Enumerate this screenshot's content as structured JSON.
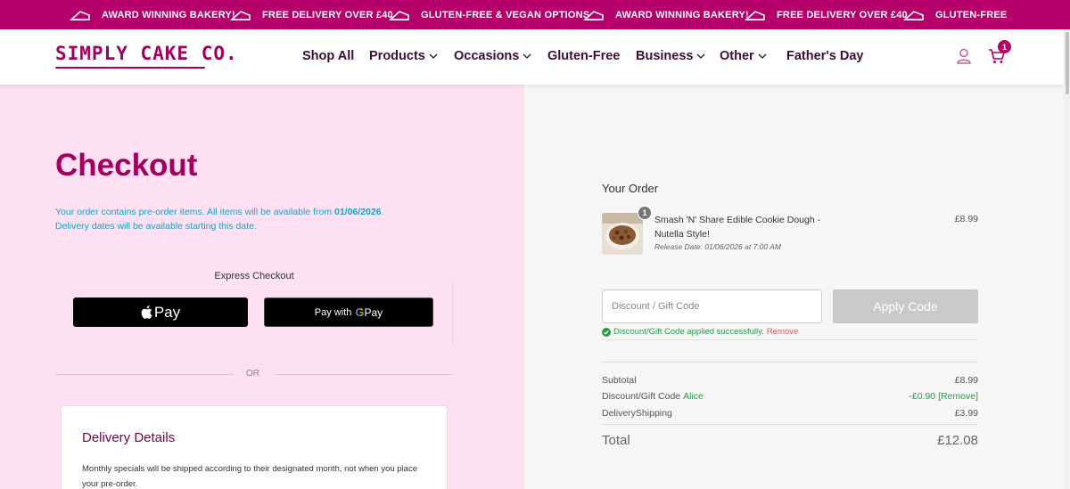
{
  "announcement": {
    "items": [
      "AWARD WINNING BAKERY!",
      "FREE DELIVERY OVER £40",
      "GLUTEN-FREE & VEGAN OPTIONS",
      "AWARD WINNING BAKERY!",
      "FREE DELIVERY OVER £40",
      "GLUTEN-FREE"
    ],
    "icon": "cake-icon"
  },
  "header": {
    "logo": "SIMPLY CAKE CO.",
    "nav": [
      {
        "label": "Shop All",
        "dropdown": false
      },
      {
        "label": "Products",
        "dropdown": true
      },
      {
        "label": "Occasions",
        "dropdown": true
      },
      {
        "label": "Gluten-Free",
        "dropdown": false
      },
      {
        "label": "Business",
        "dropdown": true
      },
      {
        "label": "Other",
        "dropdown": true
      },
      {
        "label": "Father's Day",
        "dropdown": false
      }
    ],
    "cart_count": "1"
  },
  "checkout": {
    "title": "Checkout",
    "preorder_text_1": "Your order contains pre-order items. All items will be available from ",
    "preorder_date": "01/06/2026",
    "preorder_text_2": ".",
    "preorder_text_3": "Delivery dates will be available starting this date.",
    "express_label": "Express Checkout",
    "apple_pay_label": "Pay",
    "gpay_prefix": "Pay with",
    "gpay_suffix": "Pay",
    "or_label": "OR",
    "delivery_title": "Delivery Details",
    "delivery_text": "Monthly specials will be shipped according to their designated month, not when you place your pre-order."
  },
  "order": {
    "heading": "Your Order",
    "item": {
      "qty": "1",
      "name": "Smash 'N' Share Edible Cookie Dough - Nutella Style!",
      "release": "Release Date: 01/06/2026 at 7:00 AM",
      "price": "£8.99"
    },
    "code_placeholder": "Discount / Gift Code",
    "apply_label": "Apply Code",
    "success_text": "Discount/Gift Code applied successfully.",
    "remove_label": "Remove",
    "subtotal_label": "Subtotal",
    "subtotal_value": "£8.99",
    "discount_label": "Discount/Gift Code",
    "discount_code": "Alice",
    "discount_value": "-£0.90 [Remove]",
    "shipping_label": "DeliveryShipping",
    "shipping_value": "£3.99",
    "total_label": "Total",
    "total_value": "£12.08"
  },
  "colors": {
    "brand": "#b5006b",
    "title": "#a0005e",
    "left_bg": "#fde0f1",
    "right_bg": "#f6f6f6",
    "success": "#2a9a4a",
    "info": "#1ca0c8"
  }
}
